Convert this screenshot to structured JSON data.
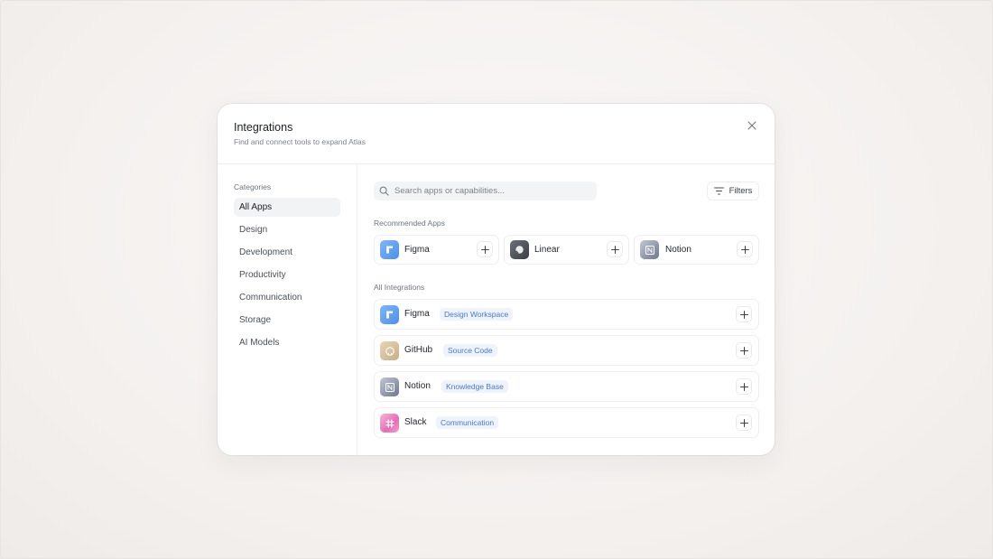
{
  "dialog": {
    "title": "Integrations",
    "subtitle": "Find and connect tools to expand Atlas"
  },
  "sidebar": {
    "heading": "Categories",
    "items": [
      {
        "label": "All Apps",
        "active": true
      },
      {
        "label": "Design"
      },
      {
        "label": "Development"
      },
      {
        "label": "Productivity"
      },
      {
        "label": "Communication"
      },
      {
        "label": "Storage"
      },
      {
        "label": "AI Models"
      }
    ]
  },
  "search": {
    "placeholder": "Search apps or capabilities..."
  },
  "filters": {
    "label": "Filters"
  },
  "recommended": {
    "heading": "Recommended Apps",
    "apps": [
      {
        "name": "Figma",
        "icon": "figma-icon"
      },
      {
        "name": "Linear",
        "icon": "linear-icon"
      },
      {
        "name": "Notion",
        "icon": "notion-icon"
      }
    ]
  },
  "all": {
    "heading": "All Integrations",
    "apps": [
      {
        "name": "Figma",
        "tag": "Design Workspace",
        "icon": "figma-icon"
      },
      {
        "name": "GitHub",
        "tag": "Source Code",
        "icon": "github-icon"
      },
      {
        "name": "Notion",
        "tag": "Knowledge Base",
        "icon": "notion-icon"
      },
      {
        "name": "Slack",
        "tag": "Communication",
        "icon": "slack-icon"
      }
    ]
  },
  "colors": {
    "accent_tag_bg": "#eef3fc",
    "accent_tag_text": "#4a78c9",
    "active_item_bg": "#f2f3f5"
  }
}
